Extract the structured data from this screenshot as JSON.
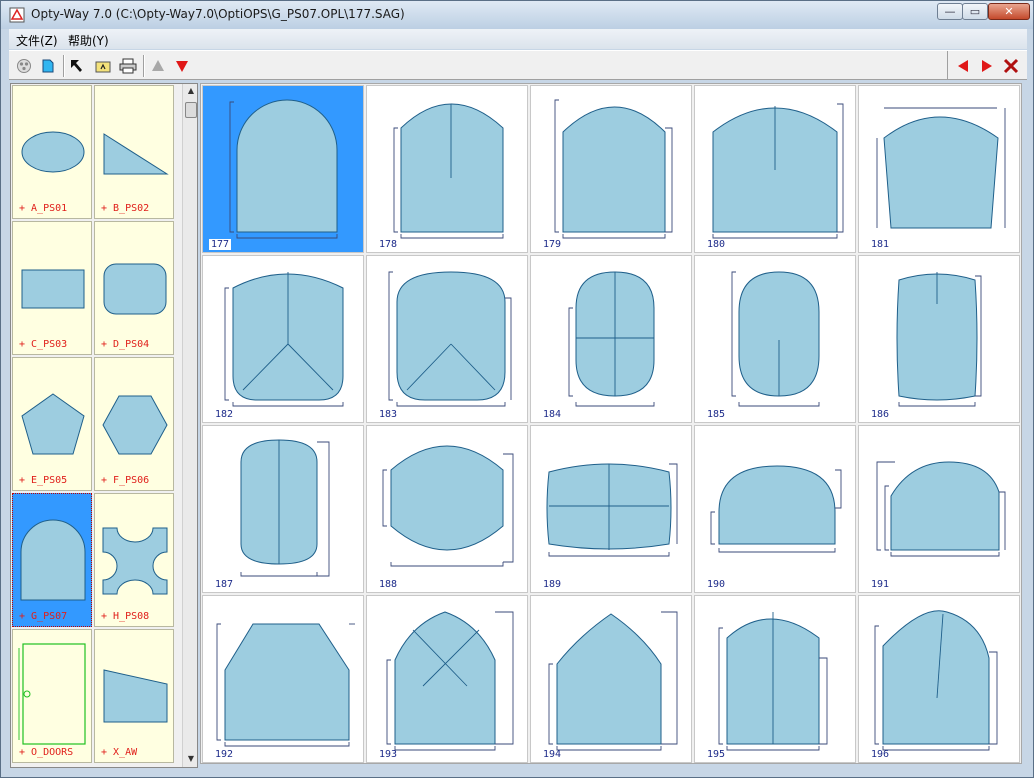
{
  "window": {
    "title": "Opty-Way 7.0 (C:\\Opty-Way7.0\\OptiOPS\\G_PS07.OPL\\177.SAG)",
    "buttons": {
      "minimize": "—",
      "maximize": "▭",
      "close": "✕"
    }
  },
  "menu": {
    "items": [
      "文件(Z)",
      "帮助(Y)"
    ]
  },
  "toolbar": {
    "left": [
      "disk-icon",
      "new-shape-icon",
      "pointer-arrow-icon",
      "open-folder-icon",
      "print-icon",
      "up-triangle-icon",
      "down-triangle-icon"
    ],
    "right": [
      "prev-red-icon",
      "next-red-icon",
      "close-x-icon"
    ]
  },
  "families": [
    {
      "id": "A",
      "label": "+ A_PS01",
      "shape": "ellipse"
    },
    {
      "id": "B",
      "label": "+ B_PS02",
      "shape": "triangle"
    },
    {
      "id": "C",
      "label": "+ C_PS03",
      "shape": "rect"
    },
    {
      "id": "D",
      "label": "+ D_PS04",
      "shape": "roundrect"
    },
    {
      "id": "E",
      "label": "+ E_PS05",
      "shape": "pentagon"
    },
    {
      "id": "F",
      "label": "+ F_PS06",
      "shape": "hexagon"
    },
    {
      "id": "G",
      "label": "+ G_PS07",
      "shape": "arch",
      "selected": true
    },
    {
      "id": "H",
      "label": "+ H_PS08",
      "shape": "notched"
    },
    {
      "id": "O",
      "label": "+ O_DOORS",
      "shape": "door"
    },
    {
      "id": "X",
      "label": "+ X_AW",
      "shape": "trapezoid"
    }
  ],
  "shapes": [
    {
      "number": "177",
      "kind": "archFull",
      "selected": true
    },
    {
      "number": "178",
      "kind": "archDim"
    },
    {
      "number": "179",
      "kind": "archFlat"
    },
    {
      "number": "180",
      "kind": "archWide"
    },
    {
      "number": "181",
      "kind": "archTaper"
    },
    {
      "number": "182",
      "kind": "roundBotCorner"
    },
    {
      "number": "183",
      "kind": "roundBoth"
    },
    {
      "number": "184",
      "kind": "capsuleCross"
    },
    {
      "number": "185",
      "kind": "capsule"
    },
    {
      "number": "186",
      "kind": "barrelNarrow"
    },
    {
      "number": "187",
      "kind": "capsuleTall"
    },
    {
      "number": "188",
      "kind": "barrelWide"
    },
    {
      "number": "189",
      "kind": "barrelCross"
    },
    {
      "number": "190",
      "kind": "domeLow"
    },
    {
      "number": "191",
      "kind": "domeStep"
    },
    {
      "number": "192",
      "kind": "octTop"
    },
    {
      "number": "193",
      "kind": "gothicX"
    },
    {
      "number": "194",
      "kind": "gothic"
    },
    {
      "number": "195",
      "kind": "archSplit"
    },
    {
      "number": "196",
      "kind": "archSlant"
    }
  ],
  "colors": {
    "fill": "#9dcde0",
    "stroke": "#1f5f8a",
    "dim": "#3a4a7a",
    "selectedBg": "#3399ff",
    "familyBg": "#ffffe1",
    "familyLabel": "#e0201b",
    "numberColor": "#1d2b8a"
  }
}
